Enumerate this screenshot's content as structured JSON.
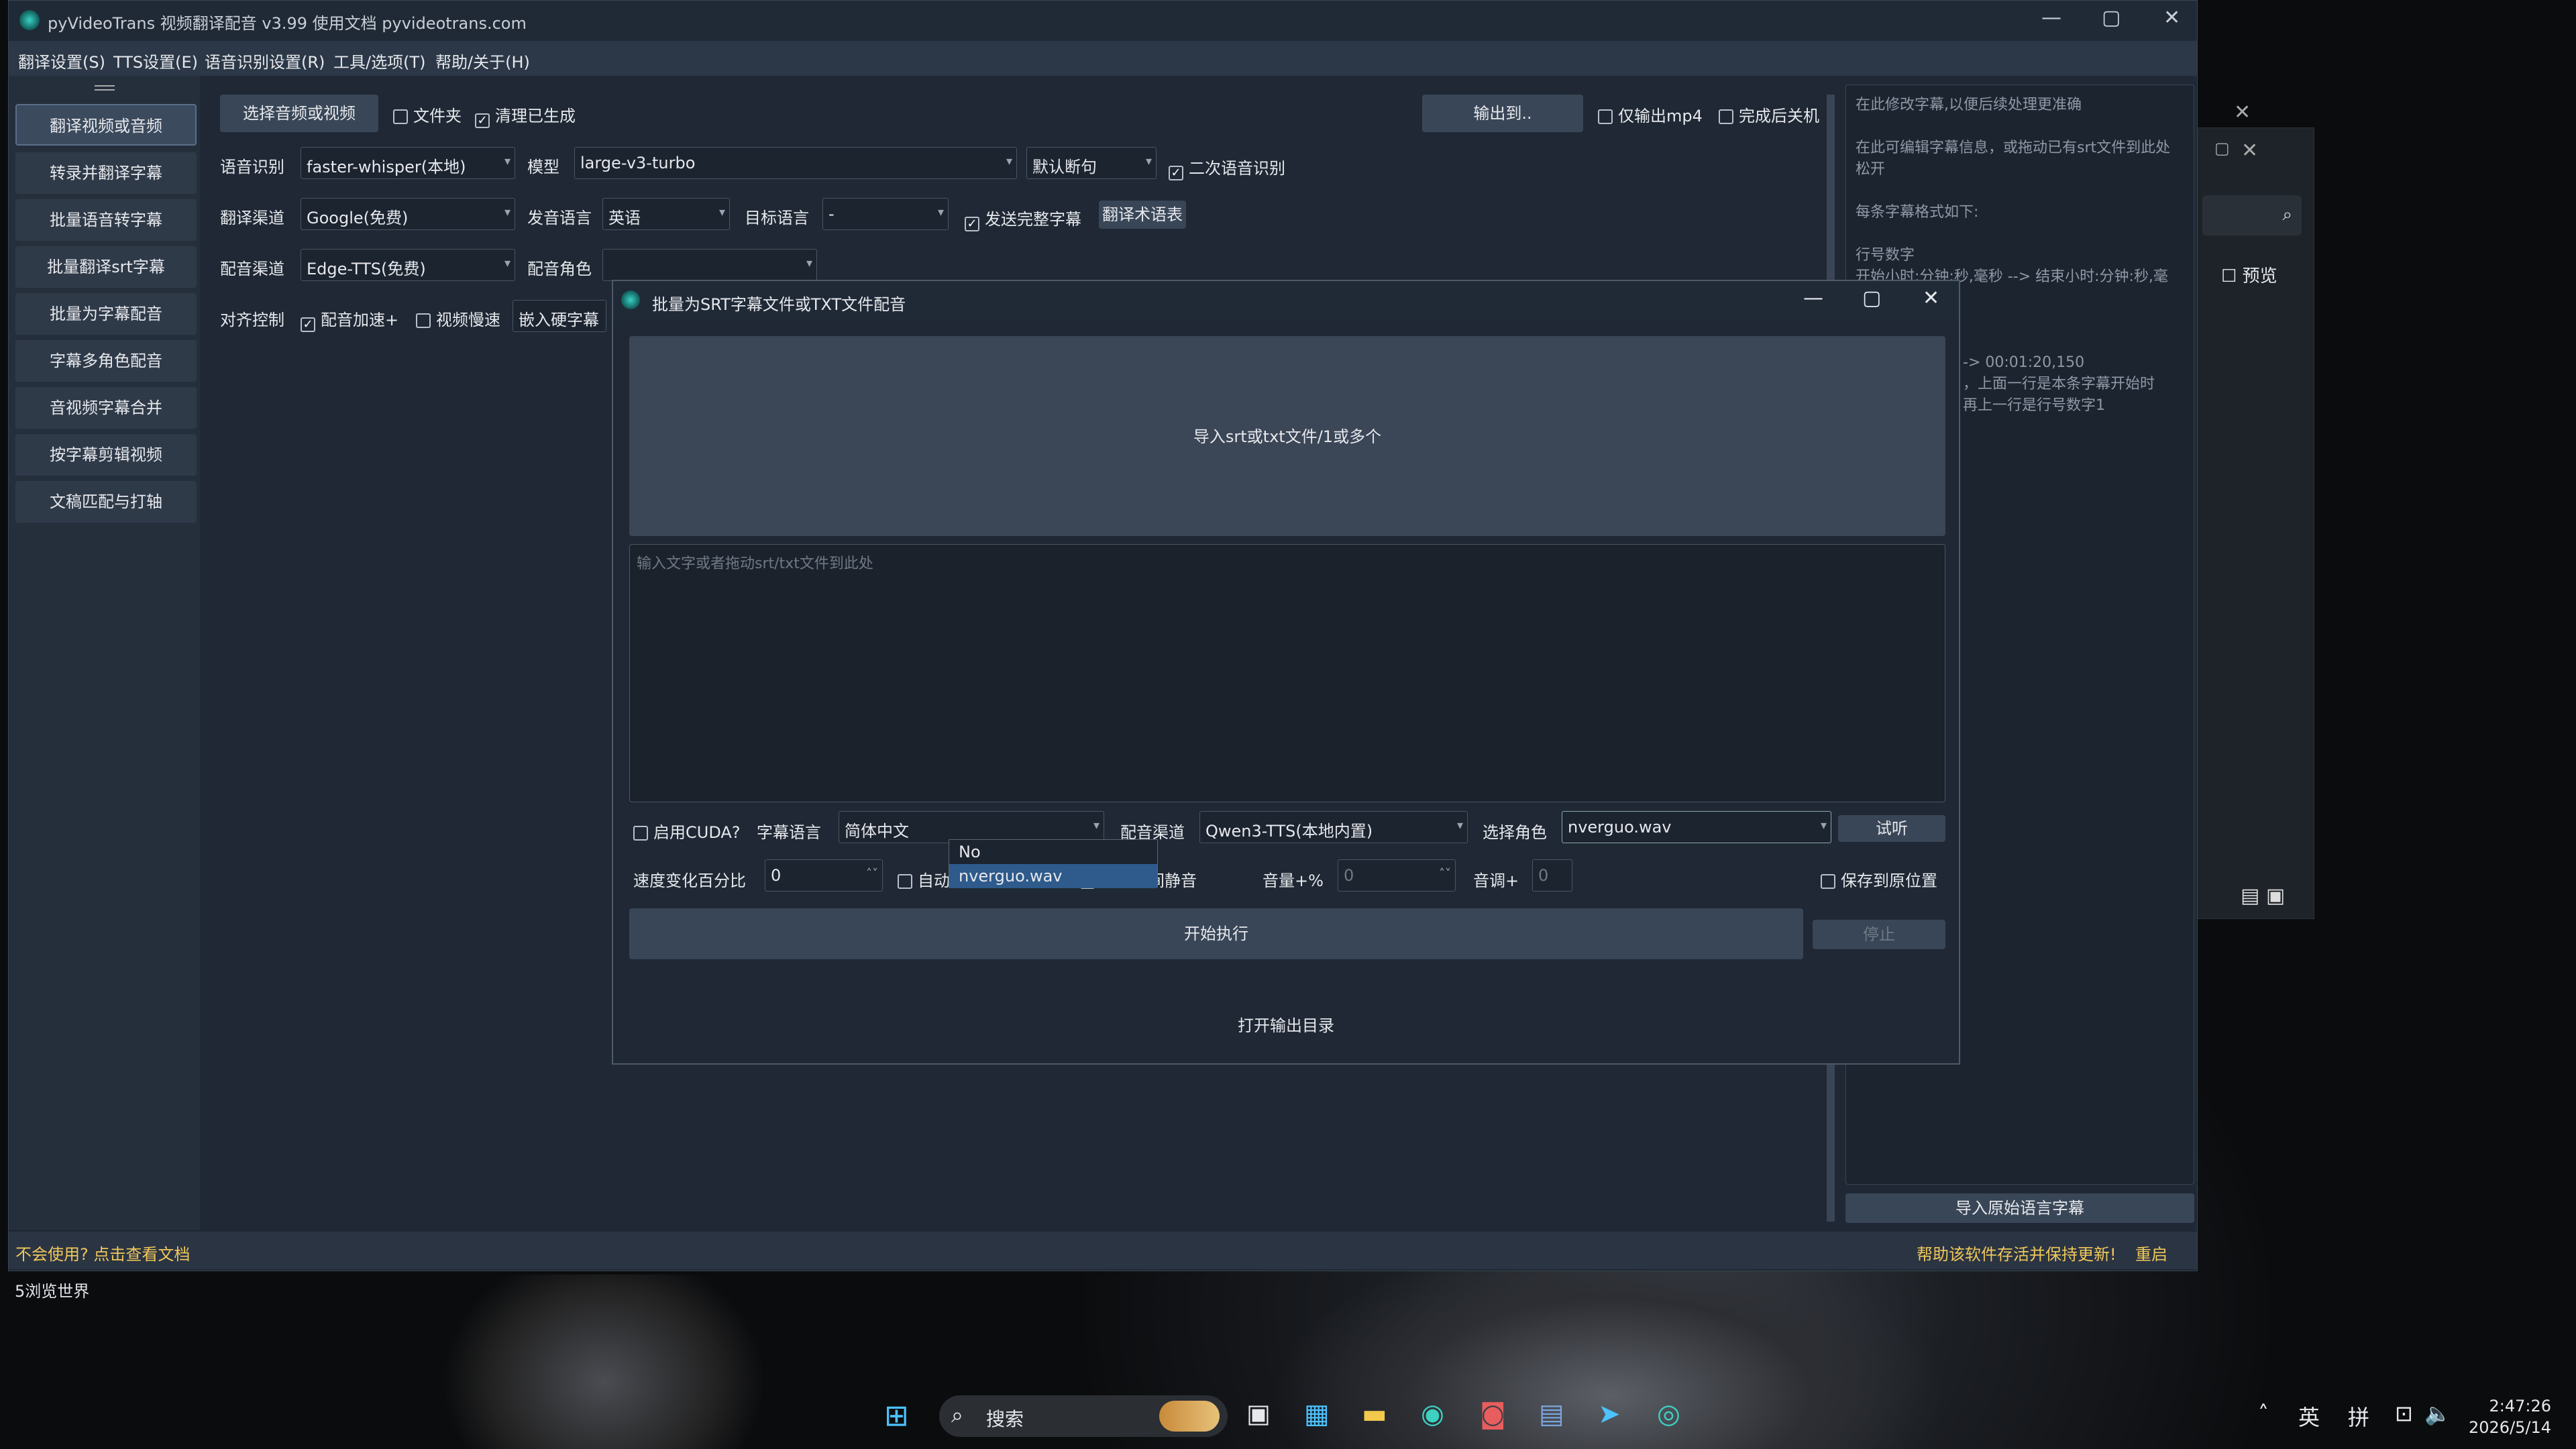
{
  "main_window": {
    "title": "pyVideoTrans 视频翻译配音 v3.99 使用文档 pyvideotrans.com",
    "menu": [
      "翻译设置(S)",
      "TTS设置(E)",
      "语音识别设置(R)",
      "工具/选项(T)",
      "帮助/关于(H)"
    ],
    "nav": [
      "翻译视频或音频",
      "转录并翻译字幕",
      "批量语音转字幕",
      "批量翻译srt字幕",
      "批量为字幕配音",
      "字幕多角色配音",
      "音视频字幕合并",
      "按字幕剪辑视频",
      "文稿匹配与打轴"
    ],
    "select_file_btn": "选择音频或视频",
    "folder_cb": "文件夹",
    "clean_cb": "清理已生成",
    "output_btn": "输出到..",
    "only_mp4_cb": "仅输出mp4",
    "shutdown_cb": "完成后关机",
    "asr_label": "语音识别",
    "asr_value": "faster-whisper(本地)",
    "model_label": "模型",
    "model_value": "large-v3-turbo",
    "split_value": "默认断句",
    "second_asr_cb": "二次语音识别",
    "trans_label": "翻译渠道",
    "trans_value": "Google(免费)",
    "src_lang_label": "发音语言",
    "src_lang_value": "英语",
    "tgt_lang_label": "目标语言",
    "tgt_lang_value": "-",
    "send_full_cb": "发送完整字幕",
    "glossary_btn": "翻译术语表",
    "tts_label": "配音渠道",
    "tts_value": "Edge-TTS(免费)",
    "role_label": "配音角色",
    "role_value": "",
    "align_label": "对齐控制",
    "speedup_cb": "配音加速+",
    "slow_cb": "视频慢速",
    "hardsub_value": "嵌入硬字幕",
    "right_panel_lines": [
      "在此修改字幕,以便后续处理更准确",
      "",
      "在此可编辑字幕信息，或拖动已有srt文件到此处松开",
      "",
      "每条字幕格式如下:",
      "",
      "行号数字",
      "开始小时:分钟:秒,毫秒 --> 结束小时:分钟:秒,毫",
      "",
      "",
      "",
      "-> 00:01:20,150",
      "，上面一行是本条字幕开始时",
      "再上一行是行号数字1"
    ],
    "import_orig_btn": "导入原始语言字幕",
    "status_left": "不会使用? 点击查看文档",
    "status_right": "帮助该软件存活并保持更新!",
    "restart": "重启"
  },
  "dialog": {
    "title": "批量为SRT字幕文件或TXT文件配音",
    "dropzone": "导入srt或txt文件/1或多个",
    "placeholder": "输入文字或者拖动srt/txt文件到此处",
    "cuda_cb": "启用CUDA?",
    "sub_lang_label": "字幕语言",
    "sub_lang_value": "简体中文",
    "tts_label": "配音渠道",
    "tts_value": "Qwen3-TTS(本地内置)",
    "role_label": "选择角色",
    "role_value": "nverguo.wav",
    "listen_btn": "试听",
    "speed_label": "速度变化百分比",
    "speed_value": "0",
    "auto_speed_cb": "自动加速?",
    "remove_silence_cb": "删字幕间静音",
    "volume_label": "音量+%",
    "volume_value": "0",
    "pitch_label": "音调+",
    "pitch_value": "0",
    "save_orig_cb": "保存到原位置",
    "role_options": [
      "No",
      "nverguo.wav"
    ],
    "run_btn": "开始执行",
    "stop_btn": "停止",
    "open_out": "打开输出目录"
  },
  "bg_window": {
    "preview": "预览"
  },
  "desktop": {
    "label": "5浏览世界"
  },
  "taskbar": {
    "search": "搜索",
    "ime1": "英",
    "ime2": "拼",
    "time": "2:47:26",
    "date": "2026/5/14"
  }
}
